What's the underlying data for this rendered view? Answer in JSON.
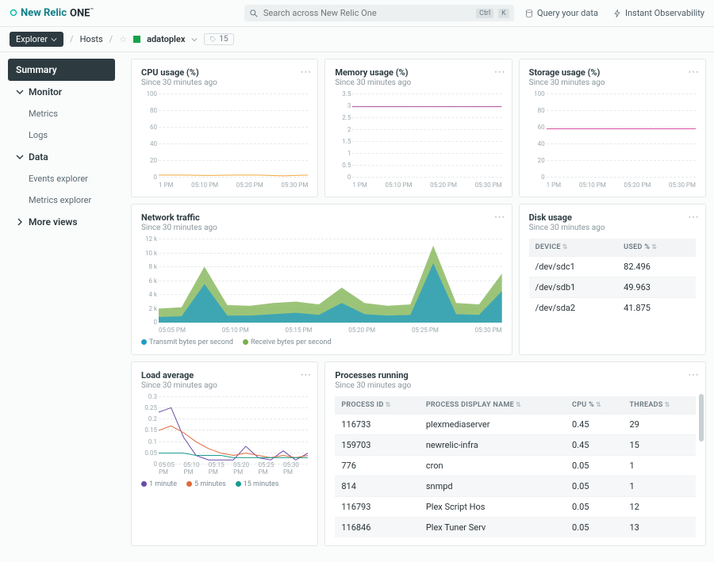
{
  "logo": {
    "brand": "New Relic",
    "product": "ONE",
    "tm": "™"
  },
  "search": {
    "placeholder": "Search across New Relic One",
    "kbd1": "Ctrl",
    "kbd2": "K"
  },
  "header_links": {
    "query": "Query your data",
    "obs": "Instant Observability"
  },
  "breadcrumb": {
    "explorer": "Explorer",
    "hosts": "Hosts",
    "host": "adatoplex",
    "tag_count": "15"
  },
  "sidebar": {
    "summary": "Summary",
    "monitor": "Monitor",
    "metrics": "Metrics",
    "logs": "Logs",
    "data": "Data",
    "events_explorer": "Events explorer",
    "metrics_explorer": "Metrics explorer",
    "more_views": "More views"
  },
  "since": "Since 30 minutes ago",
  "cards": {
    "cpu": {
      "title": "CPU usage (%)"
    },
    "memory": {
      "title": "Memory usage (%)"
    },
    "storage": {
      "title": "Storage usage (%)"
    },
    "network": {
      "title": "Network traffic"
    },
    "disk": {
      "title": "Disk usage",
      "col_device": "DEVICE",
      "col_used": "USED %"
    },
    "load": {
      "title": "Load average"
    },
    "proc": {
      "title": "Processes running",
      "col_pid": "PROCESS ID",
      "col_name": "PROCESS DISPLAY NAME",
      "col_cpu": "CPU %",
      "col_thr": "THREADS"
    }
  },
  "legend": {
    "net_tx": "Transmit bytes per second",
    "net_rx": "Receive bytes per second",
    "load1": "1 minute",
    "load5": "5 minutes",
    "load15": "15 minutes"
  },
  "disk_rows": [
    {
      "device": "/dev/sdc1",
      "used": "82.496"
    },
    {
      "device": "/dev/sdb1",
      "used": "49.963"
    },
    {
      "device": "/dev/sda2",
      "used": "41.875"
    }
  ],
  "proc_rows": [
    {
      "pid": "116733",
      "name": "plexmediaserver",
      "cpu": "0.45",
      "thr": "29"
    },
    {
      "pid": "159703",
      "name": "newrelic-infra",
      "cpu": "0.45",
      "thr": "15"
    },
    {
      "pid": "776",
      "name": "cron",
      "cpu": "0.05",
      "thr": "1"
    },
    {
      "pid": "814",
      "name": "snmpd",
      "cpu": "0.05",
      "thr": "1"
    },
    {
      "pid": "116793",
      "name": "Plex Script Hos",
      "cpu": "0.05",
      "thr": "12"
    },
    {
      "pid": "116846",
      "name": "Plex Tuner Serv",
      "cpu": "0.05",
      "thr": "13"
    }
  ],
  "chart_data": [
    {
      "type": "line",
      "title": "CPU usage (%)",
      "ylim": [
        0,
        100
      ],
      "yticks": [
        0,
        20,
        40,
        60,
        80,
        100
      ],
      "xticks": [
        "1 PM",
        "05:10 PM",
        "05:20 PM",
        "05:30 PM"
      ],
      "series": [
        {
          "name": "cpu",
          "color": "#f0a83a",
          "values": [
            3,
            3,
            2.5,
            3,
            3,
            2,
            3
          ]
        }
      ]
    },
    {
      "type": "line",
      "title": "Memory usage (%)",
      "ylim": [
        0,
        3.5
      ],
      "yticks": [
        0,
        0.5,
        1,
        1.5,
        2,
        2.5,
        3,
        3.5
      ],
      "xticks": [
        "1 PM",
        "05:10 PM",
        "05:20 PM",
        "05:30 PM"
      ],
      "series": [
        {
          "name": "memory",
          "color": "#b44fa0",
          "values": [
            2.95,
            2.95,
            2.95,
            2.95,
            2.95,
            2.95,
            2.95
          ]
        }
      ]
    },
    {
      "type": "line",
      "title": "Storage usage (%)",
      "ylim": [
        0,
        100
      ],
      "yticks": [
        0,
        20,
        40,
        60,
        80,
        100
      ],
      "xticks": [
        "1 PM",
        "05:10 PM",
        "05:20 PM",
        "05:30 PM"
      ],
      "series": [
        {
          "name": "storage",
          "color": "#d8509f",
          "values": [
            58,
            58,
            58,
            58,
            58,
            58,
            58
          ]
        }
      ]
    },
    {
      "type": "area",
      "title": "Network traffic",
      "ylim": [
        0,
        12000
      ],
      "yticks": [
        "0",
        "2 k",
        "4 k",
        "6 k",
        "8 k",
        "10 k",
        "12 k"
      ],
      "xticks": [
        "05:05 PM",
        "05:10 PM",
        "05:15 PM",
        "05:20 PM",
        "05:25 PM",
        "05:30 PM"
      ],
      "series": [
        {
          "name": "Receive bytes per second",
          "color": "#7bb04c",
          "values": [
            2000,
            2200,
            8000,
            2500,
            2400,
            2800,
            3000,
            2600,
            5000,
            2800,
            2400,
            2600,
            11000,
            2800,
            2600,
            7000
          ]
        },
        {
          "name": "Transmit bytes per second",
          "color": "#1f9cc7",
          "values": [
            800,
            900,
            5500,
            1000,
            1000,
            1200,
            1400,
            1100,
            2800,
            1200,
            1000,
            1100,
            8500,
            1200,
            1100,
            4500
          ]
        }
      ]
    },
    {
      "type": "table",
      "title": "Disk usage",
      "columns": [
        "DEVICE",
        "USED %"
      ],
      "rows": [
        [
          "/dev/sdc1",
          82.496
        ],
        [
          "/dev/sdb1",
          49.963
        ],
        [
          "/dev/sda2",
          41.875
        ]
      ]
    },
    {
      "type": "line",
      "title": "Load average",
      "ylim": [
        0,
        0.3
      ],
      "yticks": [
        0,
        0.05,
        0.1,
        0.15,
        0.2,
        0.25,
        0.3
      ],
      "xticks": [
        "05:05 PM",
        "05:10 PM",
        "05:15 PM",
        "05:20 PM",
        "05:25 PM",
        "05:30 PM"
      ],
      "series": [
        {
          "name": "1 minute",
          "color": "#6b4ba8",
          "values": [
            0.23,
            0.25,
            0.12,
            0.04,
            0.02,
            0.02,
            0.02,
            0.08,
            0.03,
            0.02,
            0.06,
            0.02,
            0.05
          ]
        },
        {
          "name": "5 minutes",
          "color": "#e06a3b",
          "values": [
            0.15,
            0.17,
            0.14,
            0.1,
            0.07,
            0.05,
            0.04,
            0.05,
            0.04,
            0.03,
            0.04,
            0.03,
            0.04
          ]
        },
        {
          "name": "15 minutes",
          "color": "#1a9b8e",
          "values": [
            0.05,
            0.05,
            0.05,
            0.04,
            0.04,
            0.04,
            0.03,
            0.03,
            0.03,
            0.03,
            0.03,
            0.03,
            0.03
          ]
        }
      ]
    },
    {
      "type": "table",
      "title": "Processes running",
      "columns": [
        "PROCESS ID",
        "PROCESS DISPLAY NAME",
        "CPU %",
        "THREADS"
      ],
      "rows": [
        [
          116733,
          "plexmediaserver",
          0.45,
          29
        ],
        [
          159703,
          "newrelic-infra",
          0.45,
          15
        ],
        [
          776,
          "cron",
          0.05,
          1
        ],
        [
          814,
          "snmpd",
          0.05,
          1
        ],
        [
          116793,
          "Plex Script Hos",
          0.05,
          12
        ],
        [
          116846,
          "Plex Tuner Serv",
          0.05,
          13
        ]
      ]
    }
  ]
}
